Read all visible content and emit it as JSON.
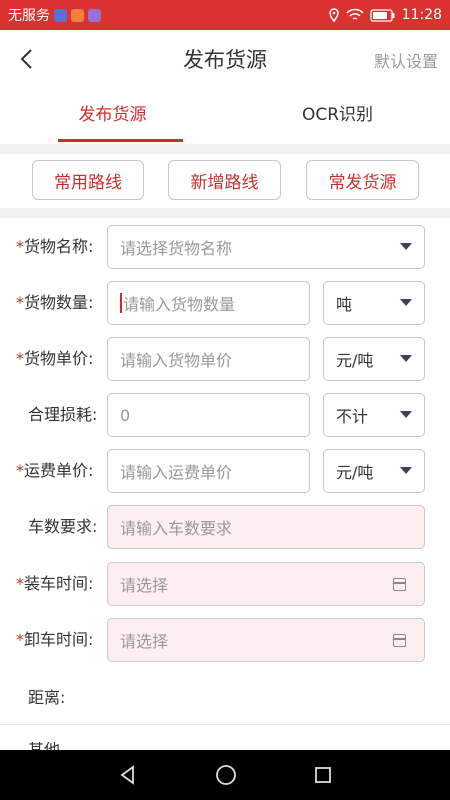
{
  "status_bar": {
    "carrier": "无服务",
    "time": "11:28",
    "bg_color": "#d9322f"
  },
  "header": {
    "title": "发布货源",
    "right_action": "默认设置"
  },
  "tabs": [
    {
      "label": "发布货源",
      "active": true
    },
    {
      "label": "OCR识别",
      "active": false
    }
  ],
  "route_buttons": [
    "常用路线",
    "新增路线",
    "常发货源"
  ],
  "form": {
    "goods_name": {
      "label": "货物名称:",
      "required": true,
      "placeholder": "请选择货物名称"
    },
    "goods_qty": {
      "label": "货物数量:",
      "required": true,
      "placeholder": "请输入货物数量",
      "unit": "吨"
    },
    "goods_price": {
      "label": "货物单价:",
      "required": true,
      "placeholder": "请输入货物单价",
      "unit": "元/吨"
    },
    "loss": {
      "label": "合理损耗:",
      "required": false,
      "value": "0",
      "unit": "不计"
    },
    "freight_price": {
      "label": "运费单价:",
      "required": true,
      "placeholder": "请输入运费单价",
      "unit": "元/吨"
    },
    "vehicle_req": {
      "label": "车数要求:",
      "required": false,
      "placeholder": "请输入车数要求"
    },
    "load_time": {
      "label": "装车时间:",
      "required": true,
      "placeholder": "请选择"
    },
    "unload_time": {
      "label": "卸车时间:",
      "required": true,
      "placeholder": "请选择"
    },
    "distance": {
      "label": "距离:"
    },
    "partial_label": "其他"
  },
  "required_mark": "*",
  "accent_color": "#c9302c"
}
